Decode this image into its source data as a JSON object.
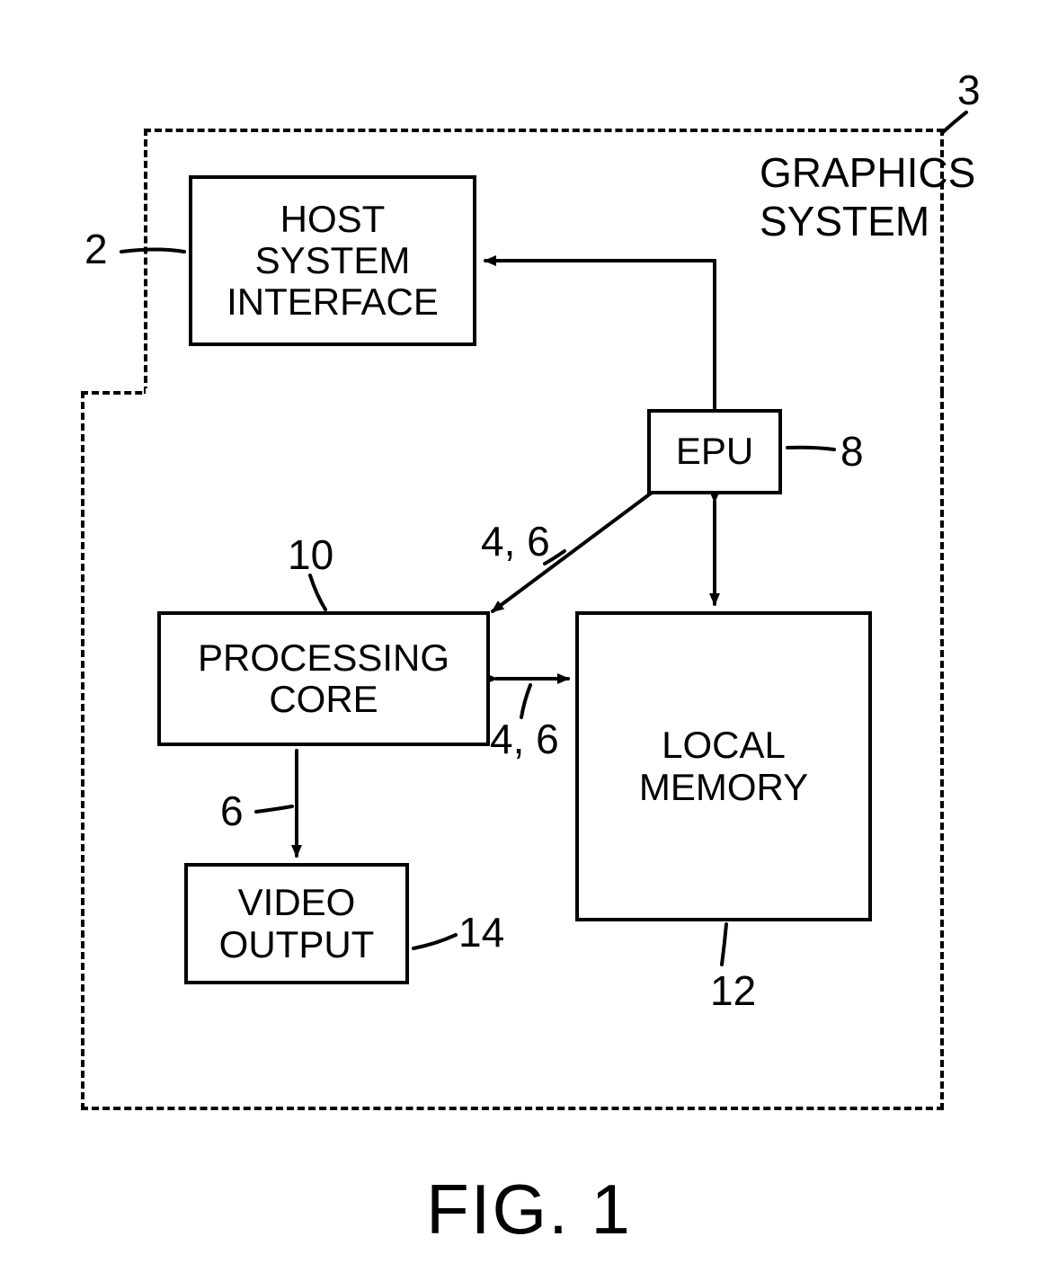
{
  "boxes": {
    "host_system_interface": "HOST\nSYSTEM\nINTERFACE",
    "epu": "EPU",
    "processing_core": "PROCESSING\nCORE",
    "local_memory": "LOCAL\nMEMORY",
    "video_output": "VIDEO\nOUTPUT"
  },
  "labels": {
    "graphics_system": "GRAPHICS\nSYSTEM"
  },
  "refs": {
    "r2": "2",
    "r3": "3",
    "r4_6_a": "4, 6",
    "r4_6_b": "4, 6",
    "r6": "6",
    "r8": "8",
    "r10": "10",
    "r12": "12",
    "r14": "14"
  },
  "figure": "FIG. 1"
}
